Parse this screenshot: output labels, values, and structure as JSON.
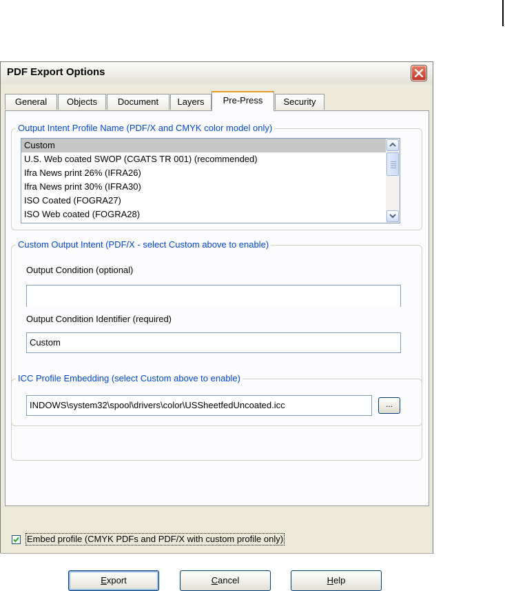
{
  "dialog": {
    "title": "PDF Export Options"
  },
  "tabs": [
    "General",
    "Objects",
    "Document",
    "Layers",
    "Pre-Press",
    "Security"
  ],
  "active_tab": "Pre-Press",
  "output_intent": {
    "legend": "Output Intent Profile Name (PDF/X and CMYK color model only)",
    "items": [
      "Custom",
      "U.S. Web coated SWOP (CGATS TR 001) (recommended)",
      "Ifra News print 26% (IFRA26)",
      "Ifra News print 30% (IFRA30)",
      "ISO Coated (FOGRA27)",
      "ISO Web coated (FOGRA28)"
    ],
    "selected": "Custom"
  },
  "custom_intent": {
    "legend": "Custom Output Intent (PDF/X - select Custom above to enable)",
    "condition_label": "Output Condition (optional)",
    "condition_value": "",
    "identifier_label": "Output Condition Identifier (required)",
    "identifier_value": "Custom"
  },
  "icc": {
    "legend": "ICC Profile Embedding (select Custom above to enable)",
    "path_value": "INDOWS\\system32\\spool\\drivers\\color\\USSheetfedUncoated.icc",
    "browse_label": "..."
  },
  "embed_profile": {
    "label": "Embed profile (CMYK PDFs and PDF/X with custom profile only)",
    "checked": true
  },
  "buttons": {
    "export": {
      "mnemonic": "E",
      "rest": "xport"
    },
    "cancel": {
      "mnemonic": "C",
      "rest": "ancel"
    },
    "help": {
      "mnemonic": "H",
      "rest": "elp"
    }
  },
  "colors": {
    "accent_tab": "#e69a2c",
    "legend_text": "#0046d5",
    "close_button": "#c2352a",
    "check": "#21a121"
  }
}
